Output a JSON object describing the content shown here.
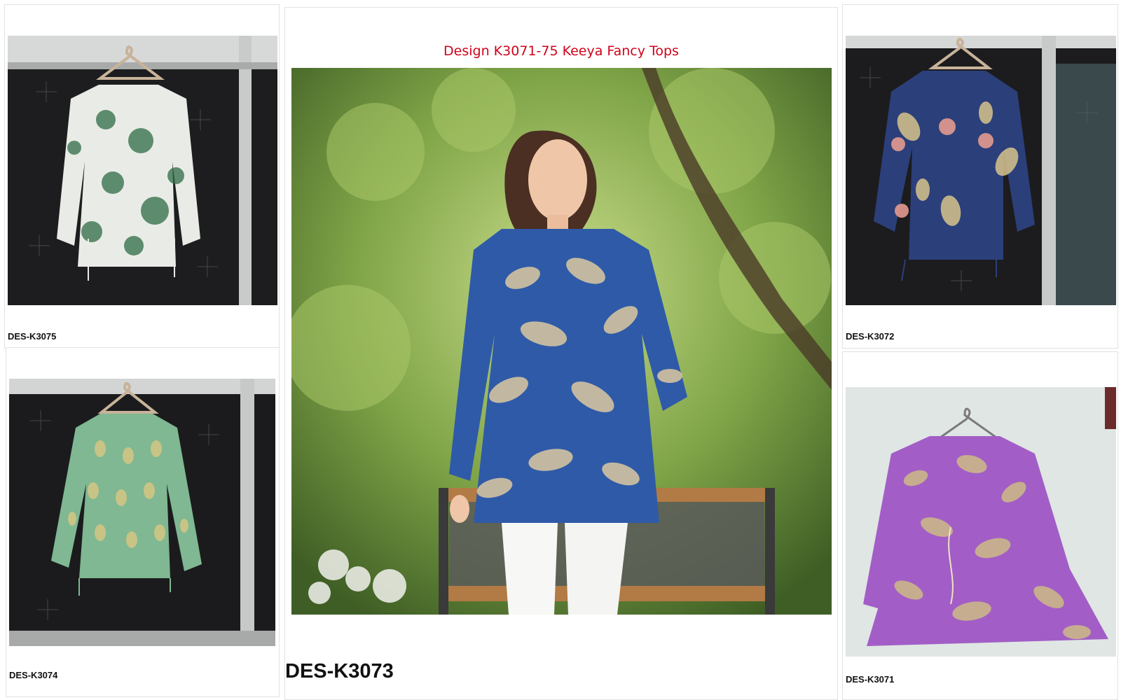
{
  "center": {
    "title": "Design K3071-75 Keeya Fancy Tops",
    "caption": "DES-K3073"
  },
  "products": [
    {
      "caption": "DES-K3075",
      "top_color": "#e9ece6",
      "print_color": "#2f6b45"
    },
    {
      "caption": "DES-K3074",
      "top_color": "#7fb892",
      "print_color": "#d9c784"
    },
    {
      "caption": "DES-K3072",
      "top_color": "#2b3f7a",
      "print_color": "#d7c48c"
    },
    {
      "caption": "DES-K3071",
      "top_color": "#a25ec6",
      "print_color": "#cdbb86"
    }
  ],
  "colors": {
    "title": "#d0021b",
    "hero_top": "#2f5aa8",
    "hero_print": "#dcc9a0",
    "foliage": "#6e9a3a"
  }
}
